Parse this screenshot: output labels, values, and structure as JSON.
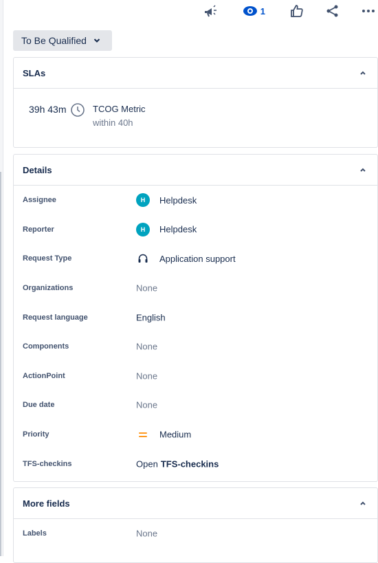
{
  "toolbar": {
    "feedback_icon": "megaphone-icon",
    "watch_icon": "eye-icon",
    "watch_count": "1",
    "like_icon": "thumbs-up-icon",
    "share_icon": "share-icon",
    "more_icon": "more-icon"
  },
  "status": {
    "label": "To Be Qualified"
  },
  "sla": {
    "title": "SLAs",
    "time_remaining": "39h 43m",
    "metric": "TCOG Metric",
    "target": "within 40h"
  },
  "details": {
    "title": "Details",
    "assignee": {
      "label": "Assignee",
      "avatar": "H",
      "value": "Helpdesk"
    },
    "reporter": {
      "label": "Reporter",
      "avatar": "H",
      "value": "Helpdesk"
    },
    "request_type": {
      "label": "Request Type",
      "value": "Application support"
    },
    "organizations": {
      "label": "Organizations",
      "value": "None"
    },
    "request_language": {
      "label": "Request language",
      "value": "English"
    },
    "components": {
      "label": "Components",
      "value": "None"
    },
    "action_point": {
      "label": "ActionPoint",
      "value": "None"
    },
    "due_date": {
      "label": "Due date",
      "value": "None"
    },
    "priority": {
      "label": "Priority",
      "value": "Medium"
    },
    "tfs_checkins": {
      "label": "TFS-checkins",
      "value_prefix": "Open",
      "value_link": "TFS-checkins"
    }
  },
  "more_fields": {
    "title": "More fields",
    "labels": {
      "label": "Labels",
      "value": "None"
    }
  },
  "colors": {
    "accent": "#0052cc",
    "avatar": "#00a3bf",
    "priority_medium": "#ff991f"
  }
}
